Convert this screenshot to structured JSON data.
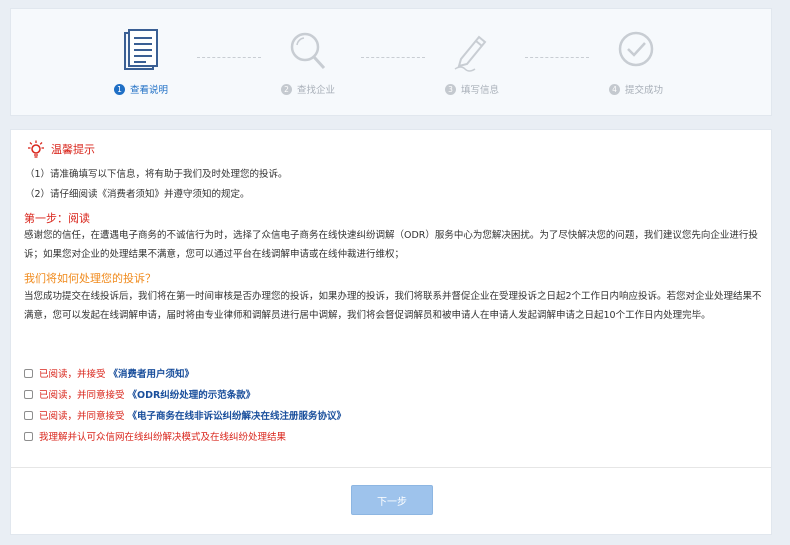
{
  "steps": [
    {
      "num": "1",
      "label": "查看说明",
      "icon": "document-icon",
      "active": true
    },
    {
      "num": "2",
      "label": "查找企业",
      "icon": "search-icon",
      "active": false
    },
    {
      "num": "3",
      "label": "填写信息",
      "icon": "pen-icon",
      "active": false
    },
    {
      "num": "4",
      "label": "提交成功",
      "icon": "check-circle-icon",
      "active": false
    }
  ],
  "tip": {
    "title": "温馨提示",
    "lines": [
      "（1）请准确填写以下信息，将有助于我们及时处理您的投诉。",
      "（2）请仔细阅读《消费者须知》并遵守须知的规定。"
    ]
  },
  "step_one": {
    "title": "第一步：阅读",
    "para1": "感谢您的信任，在遭遇电子商务的不诚信行为时，选择了众信电子商务在线快速纠纷调解（ODR）服务中心为您解决困扰。为了尽快解决您的问题，我们建议您先向企业进行投诉；如果您对企业的处理结果不满意，您可以通过平台在线调解申请或在线仲裁进行维权；",
    "subtitle": "我们将如何处理您的投诉？",
    "para2": "当您成功提交在线投诉后，我们将在第一时间审核是否办理您的投诉，如果办理的投诉，我们将联系并督促企业在受理投诉之日起2个工作日内响应投诉。若您对企业处理结果不满意，您可以发起在线调解申请，届时将由专业律师和调解员进行居中调解，我们将会督促调解员和被申请人在申请人发起调解申请之日起10个工作日内处理完毕。"
  },
  "agreements": [
    {
      "prefix": "已阅读，并接受",
      "link": "《消费者用户须知》"
    },
    {
      "prefix": "已阅读，并同意接受",
      "link": "《ODR纠纷处理的示范条款》"
    },
    {
      "prefix": "已阅读，并同意接受",
      "link": "《电子商务在线非诉讼纠纷解决在线注册服务协议》"
    },
    {
      "prefix": "我理解并认可众信网在线纠纷解决模式及在线纠纷处理结果",
      "link": ""
    }
  ],
  "next_button": "下一步",
  "colors": {
    "accent": "#1f6fc5",
    "red": "#d9261c",
    "orange": "#f08a1c",
    "button": "#9ec3ec"
  }
}
